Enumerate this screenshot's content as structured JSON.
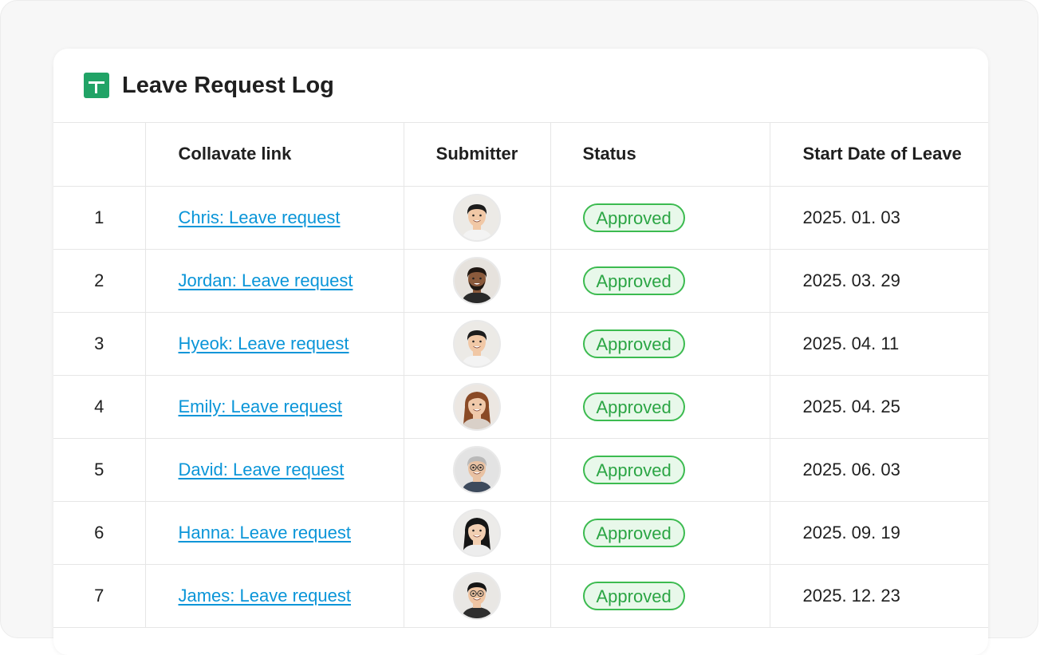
{
  "title": "Leave Request Log",
  "icon": "sheets-icon",
  "columns": {
    "num": "",
    "link": "Collavate link",
    "submitter": "Submitter",
    "status": "Status",
    "date": "Start Date of Leave"
  },
  "colors": {
    "link": "#0a95d8",
    "badge_border": "#3cbb50",
    "badge_bg": "#e8f8ea",
    "badge_text": "#2ba544",
    "sheets_green": "#21a366"
  },
  "rows": [
    {
      "num": "1",
      "link": "Chris: Leave request",
      "status": "Approved",
      "date": "2025. 01. 03",
      "avatar": "avatar-man-smiling"
    },
    {
      "num": "2",
      "link": "Jordan: Leave request",
      "status": "Approved",
      "date": "2025. 03. 29",
      "avatar": "avatar-man-beard"
    },
    {
      "num": "3",
      "link": "Hyeok: Leave request",
      "status": "Approved",
      "date": "2025. 04. 11",
      "avatar": "avatar-man-smiling"
    },
    {
      "num": "4",
      "link": "Emily: Leave request",
      "status": "Approved",
      "date": "2025. 04. 25",
      "avatar": "avatar-woman-auburn-hair"
    },
    {
      "num": "5",
      "link": "David: Leave request",
      "status": "Approved",
      "date": "2025. 06. 03",
      "avatar": "avatar-man-gray-hair-glasses"
    },
    {
      "num": "6",
      "link": "Hanna: Leave request",
      "status": "Approved",
      "date": "2025. 09. 19",
      "avatar": "avatar-woman-dark-hair"
    },
    {
      "num": "7",
      "link": "James: Leave request",
      "status": "Approved",
      "date": "2025. 12. 23",
      "avatar": "avatar-man-glasses"
    }
  ]
}
